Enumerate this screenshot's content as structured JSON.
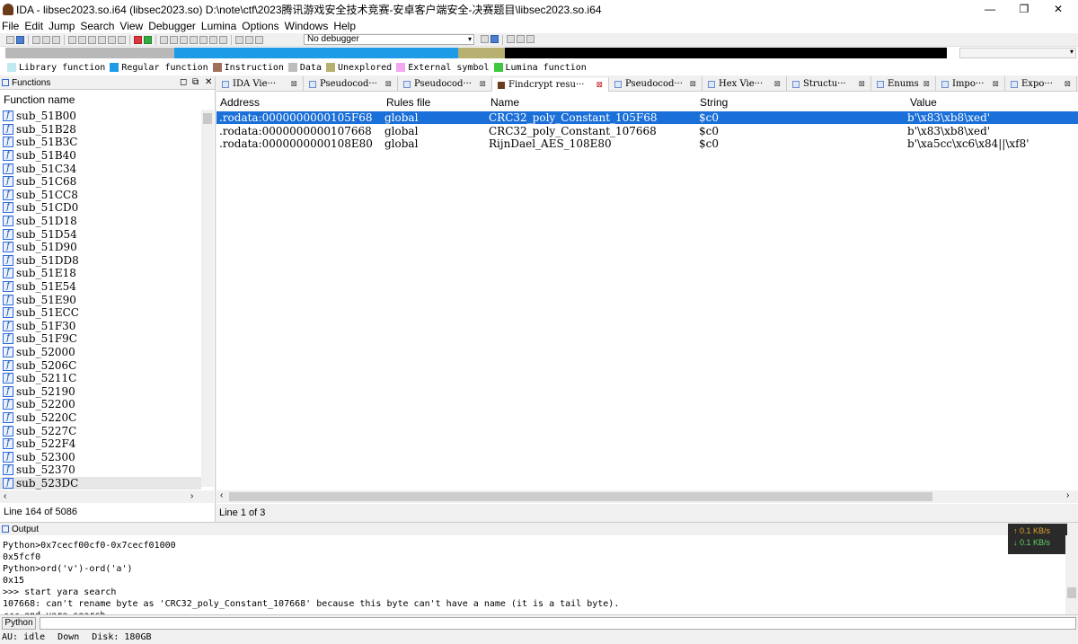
{
  "window": {
    "title": "IDA - libsec2023.so.i64 (libsec2023.so) D:\\note\\ctf\\2023腾讯游戏安全技术竞赛-安卓客户端安全-决赛题目\\libsec2023.so.i64",
    "minimize": "—",
    "maximize": "❐",
    "close": "✕"
  },
  "menu": [
    "File",
    "Edit",
    "Jump",
    "Search",
    "View",
    "Debugger",
    "Lumina",
    "Options",
    "Windows",
    "Help"
  ],
  "toolbar": {
    "debugger_select": "No debugger"
  },
  "legend": [
    {
      "label": "Library function",
      "color": "#bfe8f0"
    },
    {
      "label": "Regular function",
      "color": "#1e9be6"
    },
    {
      "label": "Instruction",
      "color": "#a0705a"
    },
    {
      "label": "Data",
      "color": "#bdbdbd"
    },
    {
      "label": "Unexplored",
      "color": "#b8b070"
    },
    {
      "label": "External symbol",
      "color": "#f4a6f0"
    },
    {
      "label": "Lumina function",
      "color": "#3ec83e"
    }
  ],
  "functions_panel": {
    "title": "Functions",
    "column": "Function name",
    "items": [
      "sub_51B00",
      "sub_51B28",
      "sub_51B3C",
      "sub_51B40",
      "sub_51C34",
      "sub_51C68",
      "sub_51CC8",
      "sub_51CD0",
      "sub_51D18",
      "sub_51D54",
      "sub_51D90",
      "sub_51DD8",
      "sub_51E18",
      "sub_51E54",
      "sub_51E90",
      "sub_51ECC",
      "sub_51F30",
      "sub_51F9C",
      "sub_52000",
      "sub_5206C",
      "sub_5211C",
      "sub_52190",
      "sub_52200",
      "sub_5220C",
      "sub_5227C",
      "sub_522F4",
      "sub_52300",
      "sub_52370",
      "sub_523DC"
    ],
    "status": "Line 164 of 5086"
  },
  "tabs": [
    "IDA Vie···",
    "Pseudocod···",
    "Pseudocod···",
    "Findcrypt resu···",
    "Pseudocod···",
    "Hex Vie···",
    "Structu···",
    "Enums",
    "Impo···",
    "Expo···"
  ],
  "findcrypt": {
    "columns": [
      "Address",
      "Rules file",
      "Name",
      "String",
      "Value"
    ],
    "rows": [
      {
        "address": ".rodata:0000000000105F68",
        "rules": "global",
        "name": "CRC32_poly_Constant_105F68",
        "string": "$c0",
        "value": "b'\\x83\\xb8\\xed'"
      },
      {
        "address": ".rodata:0000000000107668",
        "rules": "global",
        "name": "CRC32_poly_Constant_107668",
        "string": "$c0",
        "value": "b'\\x83\\xb8\\xed'"
      },
      {
        "address": ".rodata:0000000000108E80",
        "rules": "global",
        "name": "RijnDael_AES_108E80",
        "string": "$c0",
        "value": "b'\\xa5cc\\xc6\\x84||\\xf8'"
      }
    ],
    "status": "Line 1 of 3"
  },
  "output": {
    "title": "Output",
    "lines": [
      "Python>0x7cecf00cf0-0x7cecf01000",
      "0x5fcf0",
      "Python>ord('v')-ord('a')",
      "0x15",
      ">>> start yara search",
      "107668: can't rename byte as 'CRC32_poly_Constant_107668' because this byte can't have a name (it is a tail byte).",
      "<<< end yara search"
    ],
    "net_up": "↑ 0.1 KB/s",
    "net_down": "↓ 0.1 KB/s"
  },
  "python_button": "Python",
  "statusbar": {
    "au": "AU:  idle",
    "dir": "Down",
    "disk": "Disk: 180GB"
  }
}
